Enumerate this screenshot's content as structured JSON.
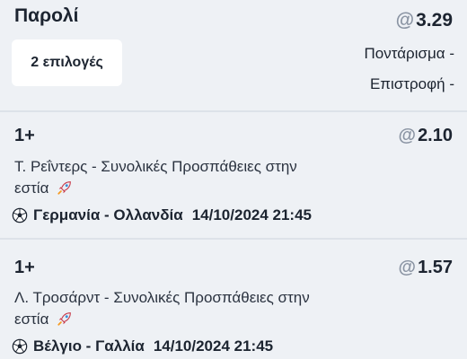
{
  "parlay": {
    "title": "Παρολί",
    "odds_prefix": "@",
    "total_odds": "3.29",
    "selections_label": "2 επιλογές",
    "stake_label": "Ποντάρισμα -",
    "return_label": "Επιστροφή -"
  },
  "legs": [
    {
      "pick": "1+",
      "odds_prefix": "@",
      "odds": "2.10",
      "market_line1": "Τ. Ρεΐντερς - Συνολικές Προσπάθειες στην",
      "market_line2": "εστία",
      "market_icon": "rocket-icon",
      "event_icon": "soccer-ball-icon",
      "event": "Γερμανία - Ολλανδία",
      "datetime": "14/10/2024 21:45"
    },
    {
      "pick": "1+",
      "odds_prefix": "@",
      "odds": "1.57",
      "market_line1": "Λ. Τροσάρντ - Συνολικές Προσπάθειες στην",
      "market_line2": "εστία",
      "market_icon": "rocket-icon",
      "event_icon": "soccer-ball-icon",
      "event": "Βέλγιο - Γαλλία",
      "datetime": "14/10/2024 21:45"
    }
  ],
  "colors": {
    "background": "#eef1f5",
    "chip": "#ffffff",
    "divider": "#dde2e9",
    "text": "#1c2430",
    "at_sign": "#8a94a3"
  }
}
